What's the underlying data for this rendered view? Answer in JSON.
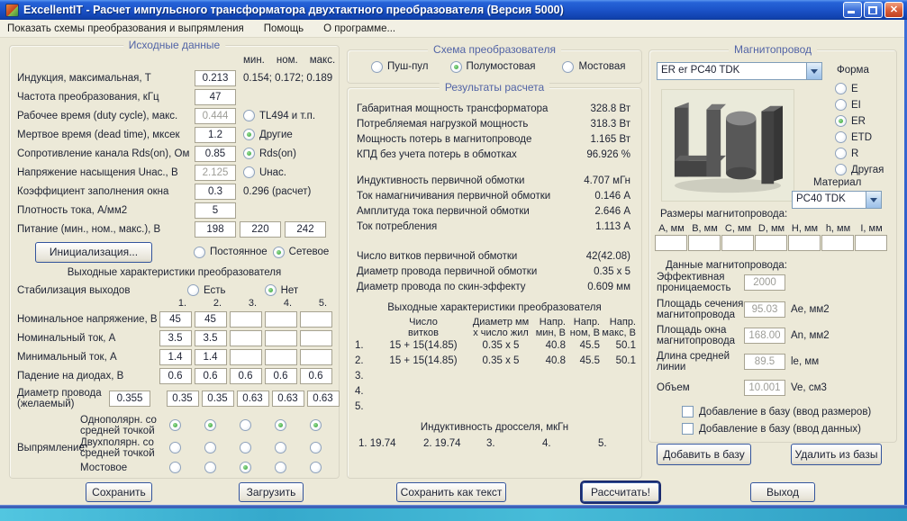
{
  "titlebar": {
    "title": "ExcellentIT - Расчет импульсного трансформатора двухтактного преобразователя (Версия 5000)"
  },
  "menu": {
    "items": [
      "Показать схемы преобразования и выпрямления",
      "Помощь",
      "О программе..."
    ]
  },
  "left": {
    "title": "Исходные данные",
    "minmax": [
      "мин.",
      "ном.",
      "макс."
    ],
    "rows": [
      {
        "label": "Индукция, максимальная, Т",
        "value": "0.213",
        "note": "0.154; 0.172; 0.189"
      },
      {
        "label": "Частота преобразования, кГц",
        "value": "47"
      },
      {
        "label": "Рабочее время (duty cycle), макс.",
        "value": "0.444",
        "radio": "TL494 и т.п.",
        "on": false
      },
      {
        "label": "Мертвое время (dead time), мксек",
        "value": "1.2",
        "radio": "Другие",
        "on": true
      },
      {
        "label": "Сопротивление канала Rds(on), Ом",
        "value": "0.85",
        "radio": "Rds(on)",
        "on": true
      },
      {
        "label": "Напряжение насыщения Uнас., В",
        "value": "2.125",
        "radio": "Uнас.",
        "on": false
      },
      {
        "label": "Коэффициент заполнения окна",
        "value": "0.3",
        "note": "0.296 (расчет)"
      },
      {
        "label": "Плотность тока, А/мм2",
        "value": "5"
      }
    ],
    "supply": {
      "label": "Питание (мин., ном., макс.), В",
      "values": [
        "198",
        "220",
        "242"
      ],
      "options": [
        {
          "label": "Постоянное",
          "on": false
        },
        {
          "label": "Сетевое",
          "on": true
        }
      ]
    },
    "init_button": "Инициализация...",
    "out": {
      "title": "Выходные характеристики преобразователя",
      "stab_label": "Стабилизация выходов",
      "stab_options": [
        {
          "label": "Есть",
          "on": false
        },
        {
          "label": "Нет",
          "on": true
        }
      ],
      "cols": [
        "1.",
        "2.",
        "3.",
        "4.",
        "5."
      ],
      "rows": [
        {
          "label": "Номинальное напряжение, В",
          "values": [
            "45",
            "45",
            "",
            "",
            ""
          ]
        },
        {
          "label": "Номинальный ток, А",
          "values": [
            "3.5",
            "3.5",
            "",
            "",
            ""
          ]
        },
        {
          "label": "Минимальный ток, А",
          "values": [
            "1.4",
            "1.4",
            "",
            "",
            ""
          ]
        },
        {
          "label": "Падение на диодах, В",
          "values": [
            "0.6",
            "0.6",
            "0.6",
            "0.6",
            "0.6"
          ]
        }
      ],
      "diameter": {
        "label": "Диаметр провода (желаемый)",
        "main": "0.355",
        "values": [
          "0.35",
          "0.35",
          "0.63",
          "0.63",
          "0.63"
        ]
      },
      "rect_label": "Выпрямление:",
      "rect_rows": [
        {
          "label": "Однополярн. со средней точкой",
          "on": [
            true,
            true,
            false,
            true,
            true
          ]
        },
        {
          "label": "Двухполярн. со средней точкой",
          "on": [
            false,
            false,
            false,
            false,
            false
          ]
        },
        {
          "label": "Мостовое",
          "on": [
            false,
            false,
            true,
            false,
            false
          ]
        }
      ]
    }
  },
  "scheme": {
    "title": "Схема преобразователя",
    "options": [
      {
        "label": "Пуш-пул",
        "on": false
      },
      {
        "label": "Полумостовая",
        "on": true
      },
      {
        "label": "Мостовая",
        "on": false
      }
    ]
  },
  "results": {
    "title": "Результаты расчета",
    "group1": [
      {
        "label": "Габаритная мощность трансформатора",
        "value": "328.8 Вт"
      },
      {
        "label": "Потребляемая нагрузкой мощность",
        "value": "318.3 Вт"
      },
      {
        "label": "Мощность потерь в магнитопроводе",
        "value": "1.165 Вт"
      },
      {
        "label": "КПД без учета потерь в обмотках",
        "value": "96.926 %"
      }
    ],
    "group2": [
      {
        "label": "Индуктивность первичной обмотки",
        "value": "4.707 мГн"
      },
      {
        "label": "Ток намагничивания первичной обмотки",
        "value": "0.146 А"
      },
      {
        "label": "Амплитуда тока первичной обмотки",
        "value": "2.646 А"
      },
      {
        "label": "Ток потребления",
        "value": "1.113 А"
      }
    ],
    "group3": [
      {
        "label": "Число витков первичной обмотки",
        "value": "42(42.08)"
      },
      {
        "label": "Диаметр провода первичной обмотки",
        "value": "0.35 x 5"
      },
      {
        "label": "Диаметр провода по скин-эффекту",
        "value": "0.609 мм"
      }
    ],
    "table": {
      "title": "Выходные характеристики преобразователя",
      "headers": [
        [
          "Число",
          "витков"
        ],
        [
          "Диаметр мм",
          "х число жил"
        ],
        [
          "Напр.",
          "мин, В"
        ],
        [
          "Напр.",
          "ном, В"
        ],
        [
          "Напр.",
          "макс, В"
        ]
      ],
      "rows": [
        [
          "1.",
          "15 + 15(14.85)",
          "0.35 x 5",
          "40.8",
          "45.5",
          "50.1"
        ],
        [
          "2.",
          "15 + 15(14.85)",
          "0.35 x 5",
          "40.8",
          "45.5",
          "50.1"
        ],
        [
          "3.",
          "",
          "",
          "",
          "",
          ""
        ],
        [
          "4.",
          "",
          "",
          "",
          "",
          ""
        ],
        [
          "5.",
          "",
          "",
          "",
          "",
          ""
        ]
      ]
    },
    "choke": {
      "title": "Индуктивность дросселя, мкГн",
      "items": [
        "1. 19.74",
        "2. 19.74",
        "3.",
        "4.",
        "5."
      ]
    }
  },
  "core": {
    "title": "Магнитопровод",
    "core_select": "ER er PC40 TDK",
    "shape_label": "Форма",
    "shapes": [
      {
        "label": "E",
        "on": false
      },
      {
        "label": "EI",
        "on": false
      },
      {
        "label": "ER",
        "on": true
      },
      {
        "label": "ETD",
        "on": false
      },
      {
        "label": "R",
        "on": false
      },
      {
        "label": "Другая",
        "on": false
      }
    ],
    "material_label": "Материал",
    "material_select": "PC40 TDK",
    "dims_title": "Размеры магнитопровода:",
    "dims_headers": [
      "A, мм",
      "B, мм",
      "C, мм",
      "D, мм",
      "H, мм",
      "h, мм",
      "I, мм"
    ],
    "data_title": "Данные магнитопровода:",
    "data_rows": [
      {
        "label1": "Эффективная",
        "label2": "проницаемость",
        "value": "2000",
        "unit": ""
      },
      {
        "label1": "Площадь сечения",
        "label2": "магнитопровода",
        "value": "95.03",
        "unit": "Ae, мм2"
      },
      {
        "label1": "Площадь окна",
        "label2": "магнитопровода",
        "value": "168.00",
        "unit": "An, мм2"
      },
      {
        "label1": "Длина средней",
        "label2": "линии",
        "value": "89.5",
        "unit": "le, мм"
      },
      {
        "label1": "Объем",
        "label2": "",
        "value": "10.001",
        "unit": "Ve, см3"
      }
    ],
    "checkboxes": [
      "Добавление в базу (ввод размеров)",
      "Добавление в базу (ввод данных)"
    ],
    "add_button": "Добавить в базу",
    "remove_button": "Удалить из базы"
  },
  "bottom": {
    "save": "Сохранить",
    "load": "Загрузить",
    "save_text": "Сохранить как текст",
    "calc": "Рассчитать!",
    "exit": "Выход"
  }
}
